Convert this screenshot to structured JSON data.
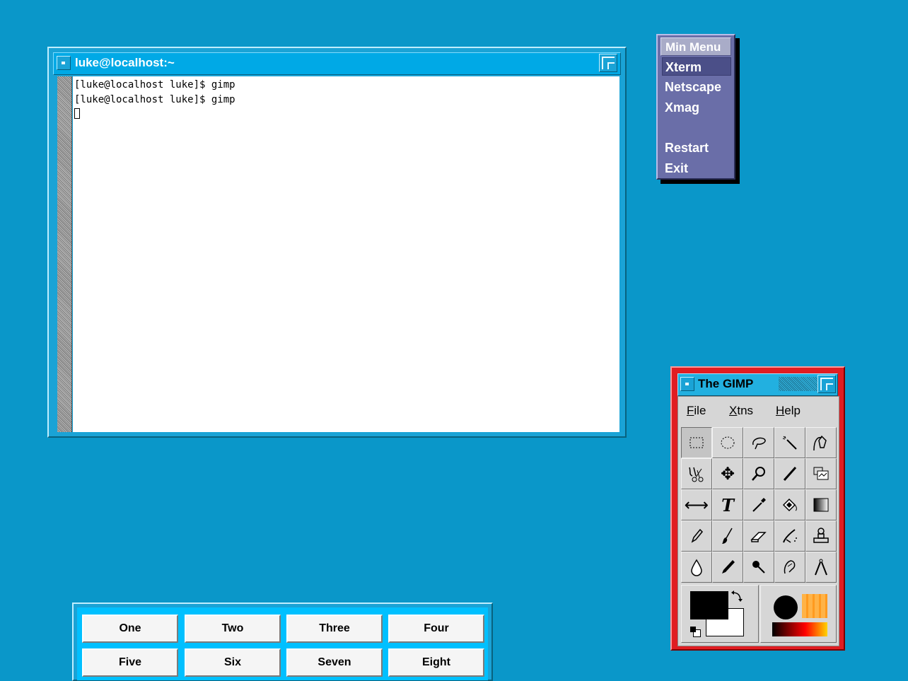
{
  "xterm": {
    "title": "luke@localhost:~",
    "lines": [
      "[luke@localhost luke]$ gimp",
      "[luke@localhost luke]$ gimp"
    ]
  },
  "min_menu": {
    "title": "Min Menu",
    "items": [
      "Xterm",
      "Netscape",
      "Xmag",
      "Restart",
      "Exit"
    ],
    "selected": "Xterm"
  },
  "gimp": {
    "title": "The GIMP",
    "menu": [
      {
        "label": "File",
        "mnemonic": "F",
        "rest": "ile"
      },
      {
        "label": "Xtns",
        "mnemonic": "X",
        "rest": "tns"
      },
      {
        "label": "Help",
        "mnemonic": "H",
        "rest": "elp"
      }
    ],
    "tools": [
      "rect-select-icon",
      "ellipse-select-icon",
      "free-select-icon",
      "fuzzy-select-icon",
      "bezier-select-icon",
      "intelligent-scissors-icon",
      "move-icon",
      "magnify-icon",
      "crop-icon",
      "transform-icon",
      "flip-icon",
      "text-icon",
      "color-picker-icon",
      "bucket-fill-icon",
      "blend-icon",
      "pencil-icon",
      "paintbrush-icon",
      "eraser-icon",
      "airbrush-icon",
      "clone-icon",
      "convolve-icon",
      "ink-icon",
      "dodge-burn-icon",
      "smudge-icon",
      "measure-icon"
    ],
    "fg_color": "#000000",
    "bg_color": "#ffffff"
  },
  "pager": {
    "desktops": [
      "One",
      "Two",
      "Three",
      "Four",
      "Five",
      "Six",
      "Seven",
      "Eight"
    ]
  },
  "colors": {
    "desktop": "#0a97c9",
    "gimp_frame": "#e01d22",
    "menu_bg": "#6a6ea8"
  }
}
